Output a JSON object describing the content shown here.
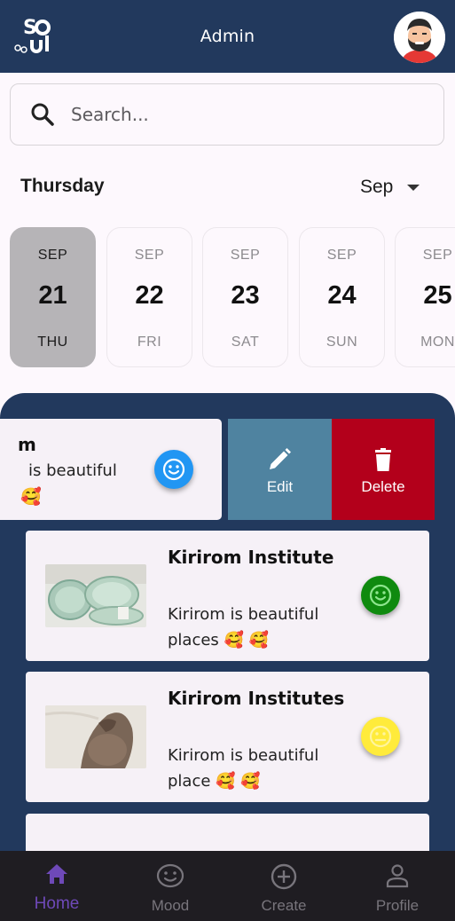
{
  "header": {
    "title": "Admin",
    "logo_text": "Soul"
  },
  "search": {
    "placeholder": "Search..."
  },
  "calendar": {
    "day_label": "Thursday",
    "month_selected": "Sep",
    "days": [
      {
        "month": "SEP",
        "num": "21",
        "dow": "THU",
        "selected": true
      },
      {
        "month": "SEP",
        "num": "22",
        "dow": "FRI"
      },
      {
        "month": "SEP",
        "num": "23",
        "dow": "SAT"
      },
      {
        "month": "SEP",
        "num": "24",
        "dow": "SUN"
      },
      {
        "month": "SEP",
        "num": "25",
        "dow": "MON"
      }
    ]
  },
  "entries": {
    "swiped": {
      "title": "m",
      "desc": "is beautiful",
      "emoji": "🥰",
      "mood_color": "#2196f3",
      "actions": {
        "edit": "Edit",
        "delete": "Delete"
      }
    },
    "items": [
      {
        "title": "Kirirom Institute",
        "desc": "Kirirom is beautiful places 🥰 🥰",
        "mood_color": "#0f8a0f",
        "mood": "happy"
      },
      {
        "title": "Kirirom Institutes",
        "desc": "Kirirom is beautiful place 🥰 🥰",
        "mood_color": "#ffeb3b",
        "mood": "neutral"
      }
    ]
  },
  "nav": {
    "home": "Home",
    "mood": "Mood",
    "create": "Create",
    "profile": "Profile"
  },
  "colors": {
    "header": "#22395d",
    "edit": "#4f83a0",
    "delete": "#b3001b",
    "nav_active": "#6e49b8"
  }
}
